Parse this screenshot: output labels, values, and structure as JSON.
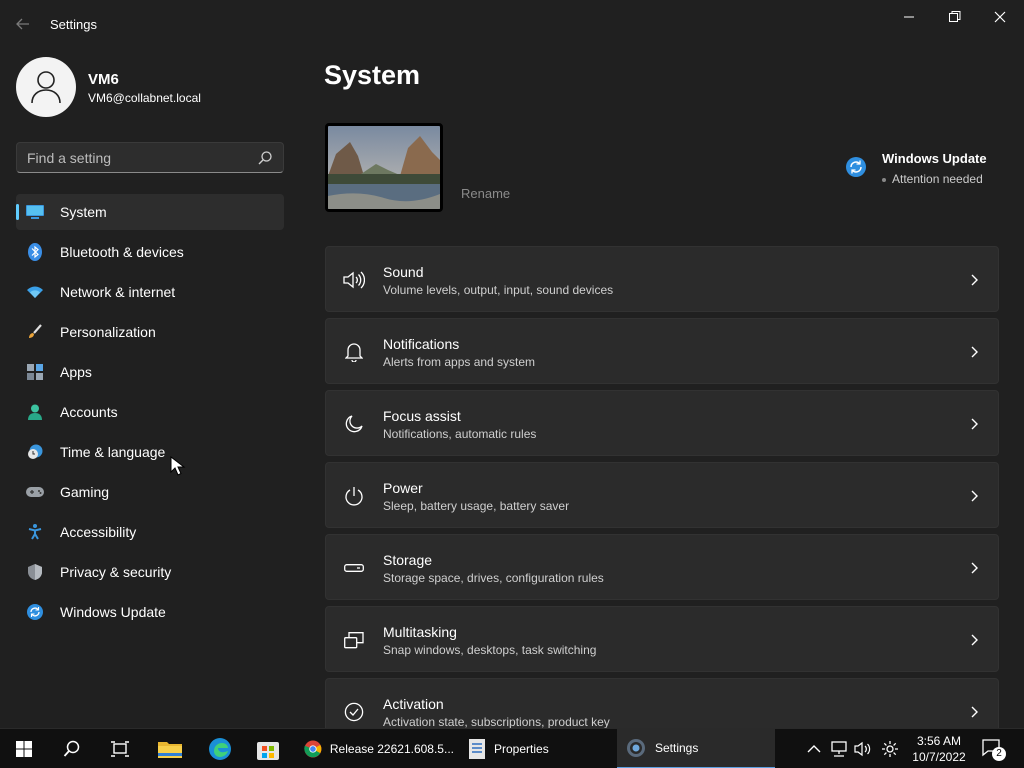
{
  "window": {
    "title": "Settings"
  },
  "profile": {
    "name": "VM6",
    "email": "VM6@collabnet.local"
  },
  "search": {
    "placeholder": "Find a setting"
  },
  "nav": [
    {
      "label": "System",
      "icon": "system-icon",
      "selected": true
    },
    {
      "label": "Bluetooth & devices",
      "icon": "bluetooth-icon"
    },
    {
      "label": "Network & internet",
      "icon": "wifi-icon"
    },
    {
      "label": "Personalization",
      "icon": "brush-icon"
    },
    {
      "label": "Apps",
      "icon": "apps-icon"
    },
    {
      "label": "Accounts",
      "icon": "person-icon"
    },
    {
      "label": "Time & language",
      "icon": "clock-globe-icon"
    },
    {
      "label": "Gaming",
      "icon": "gamepad-icon"
    },
    {
      "label": "Accessibility",
      "icon": "accessibility-icon"
    },
    {
      "label": "Privacy & security",
      "icon": "shield-icon"
    },
    {
      "label": "Windows Update",
      "icon": "update-icon"
    }
  ],
  "main": {
    "title": "System",
    "rename_label": "Rename",
    "windows_update": {
      "title": "Windows Update",
      "status": "Attention needed"
    },
    "cards": [
      {
        "title": "Sound",
        "subtitle": "Volume levels, output, input, sound devices",
        "icon": "speaker-icon"
      },
      {
        "title": "Notifications",
        "subtitle": "Alerts from apps and system",
        "icon": "bell-icon"
      },
      {
        "title": "Focus assist",
        "subtitle": "Notifications, automatic rules",
        "icon": "moon-icon"
      },
      {
        "title": "Power",
        "subtitle": "Sleep, battery usage, battery saver",
        "icon": "power-icon"
      },
      {
        "title": "Storage",
        "subtitle": "Storage space, drives, configuration rules",
        "icon": "drive-icon"
      },
      {
        "title": "Multitasking",
        "subtitle": "Snap windows, desktops, task switching",
        "icon": "multitask-icon"
      },
      {
        "title": "Activation",
        "subtitle": "Activation state, subscriptions, product key",
        "icon": "check-circle-icon"
      }
    ]
  },
  "taskbar": {
    "apps": [
      {
        "label": "Release 22621.608.5...",
        "icon": "chrome-icon"
      },
      {
        "label": "Properties",
        "icon": "properties-icon"
      },
      {
        "label": "Settings",
        "icon": "settings-gear-icon",
        "active": true
      }
    ],
    "time": "3:56 AM",
    "date": "10/7/2022",
    "notification_count": "2"
  },
  "colors": {
    "accent": "#60cdff",
    "background": "#202020",
    "card": "#2b2b2b"
  }
}
